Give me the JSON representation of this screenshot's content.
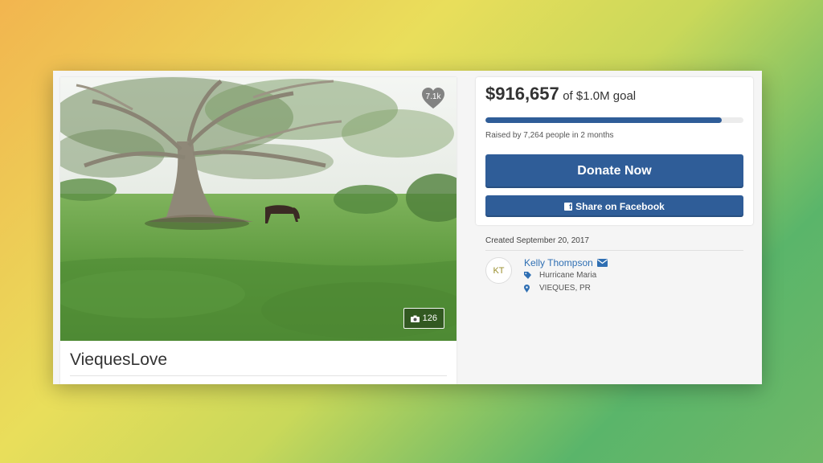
{
  "campaign": {
    "title": "ViequesLove",
    "hearts": "7.1k",
    "photo_count": "126",
    "photo_description_icons": [
      "heart-icon",
      "camera-icon"
    ]
  },
  "donation": {
    "raised": "$916,657",
    "goal_text": "of $1.0M goal",
    "progress_fraction": 0.917,
    "raised_by": "Raised by 7,264 people in 2 months",
    "donate_label": "Donate Now",
    "share_label": "Share on Facebook",
    "accent_color": "#2f5d98"
  },
  "details": {
    "created": "Created September 20, 2017",
    "organizer_initials": "KT",
    "organizer_name": "Kelly Thompson",
    "category": "Hurricane Maria",
    "location": "VIEQUES, PR",
    "icons": [
      "envelope-icon",
      "tag-icon",
      "map-pin-icon"
    ]
  }
}
